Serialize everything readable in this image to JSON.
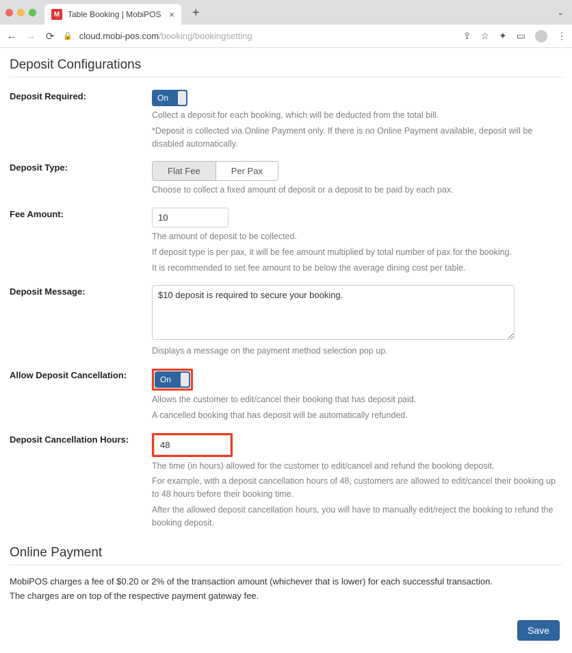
{
  "browser": {
    "tab_title": "Table Booking | MobiPOS",
    "favicon_letter": "M",
    "url_host": "cloud.mobi-pos.com",
    "url_path": "/booking/bookingsetting"
  },
  "section_deposit": {
    "heading": "Deposit Configurations",
    "deposit_required": {
      "label": "Deposit Required:",
      "toggle": "On",
      "help1": "Collect a deposit for each booking, which will be deducted from the total bill.",
      "help2": "*Deposit is collected via Online Payment only. If there is no Online Payment available, deposit will be disabled automatically."
    },
    "deposit_type": {
      "label": "Deposit Type:",
      "opt1": "Flat Fee",
      "opt2": "Per Pax",
      "help": "Choose to collect a fixed amount of deposit or a deposit to be paid by each pax."
    },
    "fee_amount": {
      "label": "Fee Amount:",
      "value": "10",
      "help1": "The amount of deposit to be collected.",
      "help2": "If deposit type is per pax, it will be fee amount multiplied by total number of pax for the booking.",
      "help3": "It is recommended to set fee amount to be below the average dining cost per table."
    },
    "deposit_message": {
      "label": "Deposit Message:",
      "value": "$10 deposit is required to secure your booking.",
      "help": "Displays a message on the payment method selection pop up."
    },
    "allow_cancel": {
      "label": "Allow Deposit Cancellation:",
      "toggle": "On",
      "help1": "Allows the customer to edit/cancel their booking that has deposit paid.",
      "help2": "A cancelled booking that has deposit will be automatically refunded."
    },
    "cancel_hours": {
      "label": "Deposit Cancellation Hours:",
      "value": "48",
      "help1": "The time (in hours) allowed for the customer to edit/cancel and refund the booking deposit.",
      "help2": "For example, with a deposit cancellation hours of 48, customers are allowed to edit/cancel their booking up to 48 hours before their booking time.",
      "help3": "After the allowed deposit cancellation hours, you will have to manually edit/reject the booking to refund the booking deposit."
    }
  },
  "section_payment": {
    "heading": "Online Payment",
    "line1": "MobiPOS charges a fee of $0.20 or 2% of the transaction amount (whichever that is lower) for each successful transaction.",
    "line2": "The charges are on top of the respective payment gateway fee."
  },
  "save_label": "Save"
}
